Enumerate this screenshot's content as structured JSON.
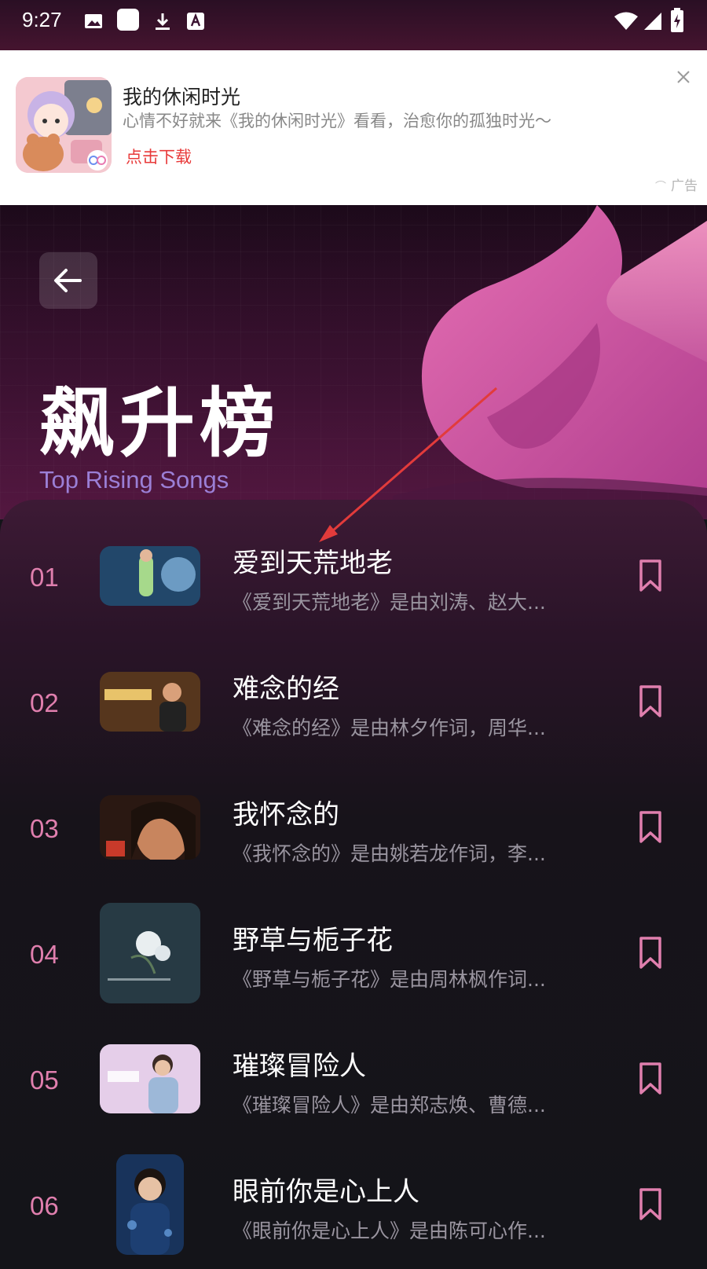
{
  "status_bar": {
    "time": "9:27"
  },
  "ad": {
    "title": "我的休闲时光",
    "description": "心情不好就来《我的休闲时光》看看，治愈你的孤独时光～",
    "cta": "点击下载",
    "label": "广告"
  },
  "header": {
    "title": "飙升榜",
    "subtitle": "Top Rising Songs"
  },
  "songs": [
    {
      "rank": "01",
      "title": "爱到天荒地老",
      "desc": "《爱到天荒地老》是由刘涛、赵大..."
    },
    {
      "rank": "02",
      "title": "难念的经",
      "desc": "《难念的经》是由林夕作词，周华..."
    },
    {
      "rank": "03",
      "title": "我怀念的",
      "desc": "《我怀念的》是由姚若龙作词，李..."
    },
    {
      "rank": "04",
      "title": "野草与栀子花",
      "desc": "《野草与栀子花》是由周林枫作词..."
    },
    {
      "rank": "05",
      "title": "璀璨冒险人",
      "desc": "《璀璨冒险人》是由郑志焕、曹德..."
    },
    {
      "rank": "06",
      "title": "眼前你是心上人",
      "desc": "《眼前你是心上人》是由陈可心作..."
    }
  ],
  "colors": {
    "rank": "#e07fae",
    "bookmark": "#e07fae",
    "subtitle": "#9b7fd6",
    "ad_cta": "#e83a3a"
  }
}
